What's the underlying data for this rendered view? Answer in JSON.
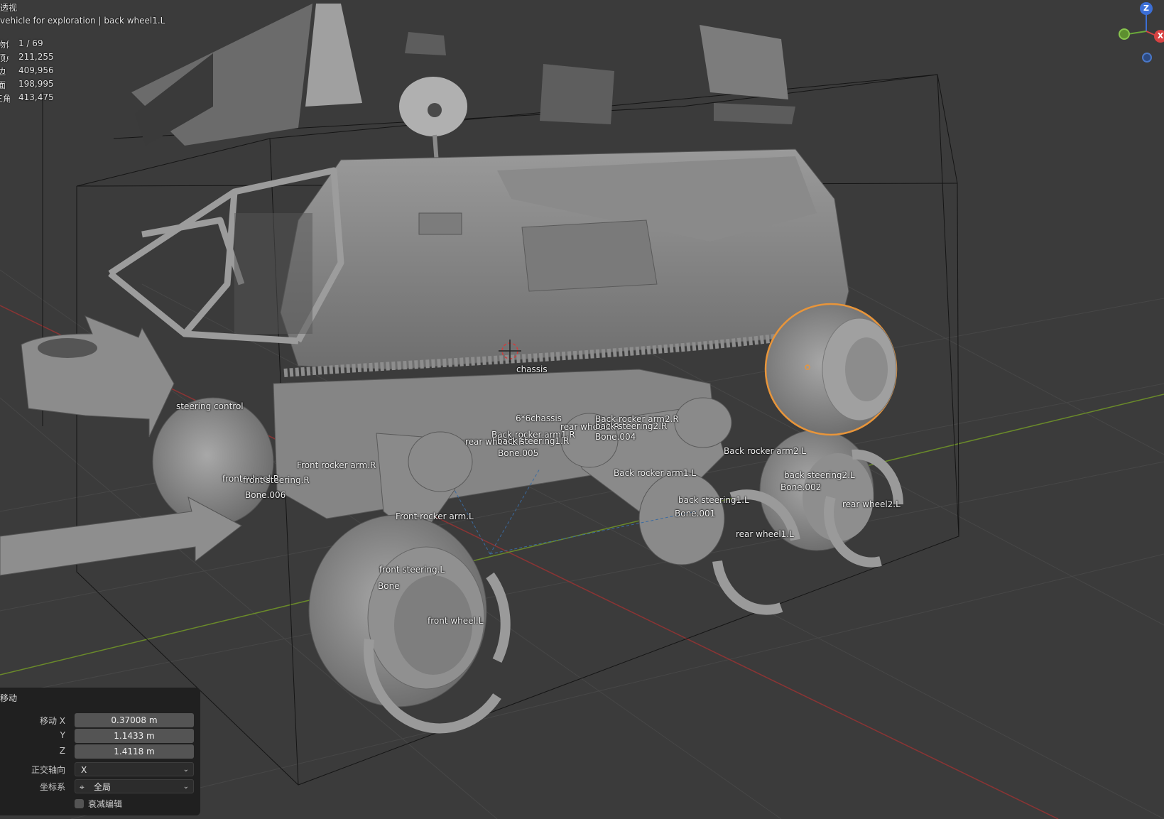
{
  "viewport": {
    "view_name": "透视",
    "collection_path": "vehicle for exploration | back wheel1.L",
    "stats": [
      {
        "label": "物体",
        "value": "1 / 69"
      },
      {
        "label": "顶点",
        "value": "211,255"
      },
      {
        "label": "边",
        "value": "409,956"
      },
      {
        "label": "面",
        "value": "198,995"
      },
      {
        "label": "三角形",
        "value": "413,475"
      }
    ]
  },
  "gizmo": {
    "z": "Z",
    "x": "X"
  },
  "bone_labels": [
    {
      "text": "chassis"
    },
    {
      "text": "steering control"
    },
    {
      "text": "6*6chassis"
    },
    {
      "text": "Back rocker arm2.R"
    },
    {
      "text": "rear wheel2.R"
    },
    {
      "text": "back steering2.R"
    },
    {
      "text": "Bone.004"
    },
    {
      "text": "Back rocker arm1.R"
    },
    {
      "text": "rear wheel1.R"
    },
    {
      "text": "back steering1.R"
    },
    {
      "text": "Bone.005"
    },
    {
      "text": "Back rocker arm2.L"
    },
    {
      "text": "Front rocker arm.R"
    },
    {
      "text": "front wheel.R"
    },
    {
      "text": "front steering.R"
    },
    {
      "text": "Bone.006"
    },
    {
      "text": "Back rocker arm1.L"
    },
    {
      "text": "back steering2.L"
    },
    {
      "text": "Bone.002"
    },
    {
      "text": "back steering1.L"
    },
    {
      "text": "Bone.001"
    },
    {
      "text": "rear wheel2.L"
    },
    {
      "text": "Front rocker arm.L"
    },
    {
      "text": "rear wheel1.L"
    },
    {
      "text": "front steering.L"
    },
    {
      "text": "Bone"
    },
    {
      "text": "front wheel.L"
    }
  ],
  "operator_panel": {
    "title": "移动",
    "move_x_label": "移动 X",
    "move_x_value": "0.37008 m",
    "y_label": "Y",
    "y_value": "1.1433 m",
    "z_label": "Z",
    "z_value": "1.4118 m",
    "orient_label": "正交轴向",
    "orient_value": "X",
    "coord_label": "坐标系",
    "coord_value": "全局",
    "falloff_label": "衰减编辑"
  }
}
